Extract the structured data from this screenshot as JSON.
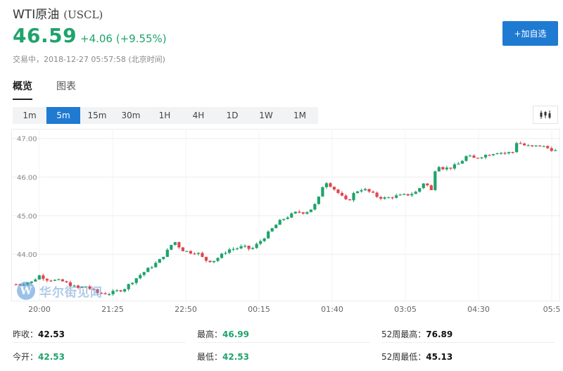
{
  "header": {
    "name": "WTI原油",
    "symbol": "(USCL)",
    "price": "46.59",
    "change": "+4.06 (+9.55%)",
    "trade_info": "交易中，2018-12-27 05:57:58 (北京时间)",
    "add_button": "+加自选"
  },
  "tabs": [
    {
      "label": "概览",
      "active": true
    },
    {
      "label": "图表",
      "active": false
    }
  ],
  "intervals": [
    {
      "label": "1m",
      "active": false
    },
    {
      "label": "5m",
      "active": true
    },
    {
      "label": "15m",
      "active": false
    },
    {
      "label": "30m",
      "active": false
    },
    {
      "label": "1H",
      "active": false
    },
    {
      "label": "4H",
      "active": false
    },
    {
      "label": "1D",
      "active": false
    },
    {
      "label": "1W",
      "active": false
    },
    {
      "label": "1M",
      "active": false
    }
  ],
  "chart_type_icon": "candlestick-icon",
  "watermark": {
    "logo": "W",
    "text": "华尔街见闻"
  },
  "colors": {
    "up": "#1ea36b",
    "down": "#e0464f",
    "accent": "#1f7ad2"
  },
  "chart_data": {
    "type": "candlestick",
    "interval": "5m",
    "y_ticks": [
      "47.00",
      "46.00",
      "45.00",
      "44.00"
    ],
    "y_tick_values": [
      47.0,
      46.0,
      45.0,
      44.0
    ],
    "ylim": [
      42.8,
      47.25
    ],
    "x_ticks": [
      "20:00",
      "21:25",
      "22:50",
      "00:15",
      "01:40",
      "03:05",
      "04:30",
      "05:5"
    ],
    "grid": true,
    "path": [
      [
        0,
        43.22
      ],
      [
        4,
        43.28
      ],
      [
        6,
        43.45
      ],
      [
        8,
        43.35
      ],
      [
        12,
        43.3
      ],
      [
        16,
        43.12
      ],
      [
        18,
        43.18
      ],
      [
        21,
        43.0
      ],
      [
        24,
        42.98
      ],
      [
        28,
        43.1
      ],
      [
        30,
        43.28
      ],
      [
        32,
        43.45
      ],
      [
        34,
        43.6
      ],
      [
        37,
        43.82
      ],
      [
        39,
        44.05
      ],
      [
        41,
        44.35
      ],
      [
        43,
        44.12
      ],
      [
        45,
        44.05
      ],
      [
        47,
        44.05
      ],
      [
        49,
        43.85
      ],
      [
        51,
        43.82
      ],
      [
        53,
        43.95
      ],
      [
        55,
        44.12
      ],
      [
        57,
        44.15
      ],
      [
        59,
        44.2
      ],
      [
        61,
        44.12
      ],
      [
        63,
        44.3
      ],
      [
        65,
        44.5
      ],
      [
        67,
        44.72
      ],
      [
        69,
        44.9
      ],
      [
        71,
        45.0
      ],
      [
        73,
        45.1
      ],
      [
        75,
        45.08
      ],
      [
        77,
        45.2
      ],
      [
        78,
        45.35
      ],
      [
        79,
        45.55
      ],
      [
        80,
        45.92
      ],
      [
        82,
        45.75
      ],
      [
        84,
        45.55
      ],
      [
        86,
        45.35
      ],
      [
        88,
        45.62
      ],
      [
        90,
        45.7
      ],
      [
        92,
        45.6
      ],
      [
        94,
        45.48
      ],
      [
        96,
        45.45
      ],
      [
        98,
        45.5
      ],
      [
        100,
        45.52
      ],
      [
        102,
        45.55
      ],
      [
        104,
        45.62
      ],
      [
        106,
        45.88
      ],
      [
        108,
        45.62
      ],
      [
        109,
        46.35
      ],
      [
        111,
        46.22
      ],
      [
        113,
        46.25
      ],
      [
        115,
        46.35
      ],
      [
        117,
        46.55
      ],
      [
        119,
        46.48
      ],
      [
        121,
        46.55
      ],
      [
        123,
        46.6
      ],
      [
        125,
        46.65
      ],
      [
        127,
        46.62
      ],
      [
        129,
        46.65
      ],
      [
        130,
        46.92
      ],
      [
        132,
        46.82
      ],
      [
        134,
        46.78
      ],
      [
        136,
        46.82
      ],
      [
        138,
        46.75
      ],
      [
        140,
        46.68
      ]
    ]
  },
  "stats": [
    {
      "label": "昨收：",
      "value": "42.53",
      "color": "dark"
    },
    {
      "label": "最高：",
      "value": "46.99",
      "color": "green"
    },
    {
      "label": "52周最高：",
      "value": "76.89",
      "color": "dark"
    },
    {
      "label": "今开：",
      "value": "42.53",
      "color": "green"
    },
    {
      "label": "最低：",
      "value": "42.53",
      "color": "green"
    },
    {
      "label": "52周最低：",
      "value": "45.13",
      "color": "dark"
    }
  ]
}
